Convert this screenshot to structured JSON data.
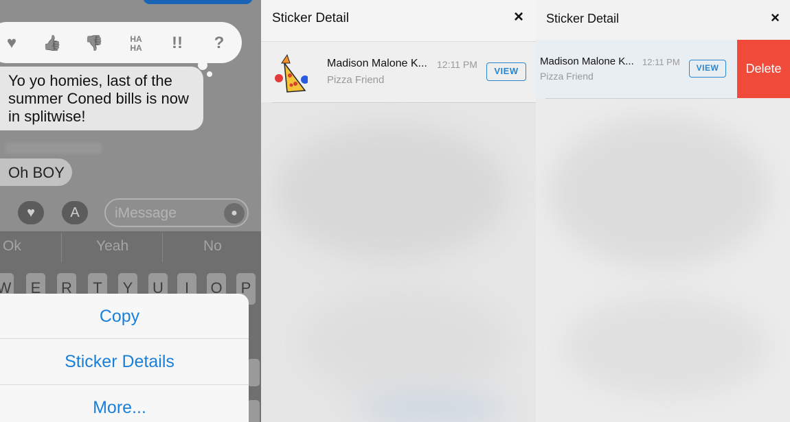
{
  "messages": {
    "tapback": [
      "♥",
      "👍",
      "👎",
      "HA HA",
      "!!",
      "?"
    ],
    "incoming_text": "Yo yo homies, last of the summer Coned bills is now in splitwise!",
    "reply_text": "Oh BOY",
    "input_placeholder": "iMessage",
    "predictions": [
      "Ok",
      "Yeah",
      "No"
    ],
    "keys": [
      "W",
      "E",
      "R",
      "T",
      "Y",
      "U",
      "I",
      "O",
      "P"
    ]
  },
  "action_sheet": {
    "copy": "Copy",
    "sticker_details": "Sticker Details",
    "more": "More..."
  },
  "sticker_detail": {
    "title": "Sticker Detail",
    "close": "×",
    "row": {
      "name": "Madison Malone K...",
      "time": "12:11 PM",
      "subtitle": "Pizza Friend",
      "view": "VIEW"
    }
  },
  "sticker_detail_swiped": {
    "title": "Sticker Detail",
    "close": "×",
    "row": {
      "name": "Madison Malone K...",
      "time": "12:11 PM",
      "subtitle": "Pizza Friend",
      "view": "VIEW",
      "delete": "Delete"
    }
  },
  "colors": {
    "accent": "#2a85d0",
    "delete": "#ef4a3a",
    "action_sheet_text": "#1a7fd9"
  }
}
